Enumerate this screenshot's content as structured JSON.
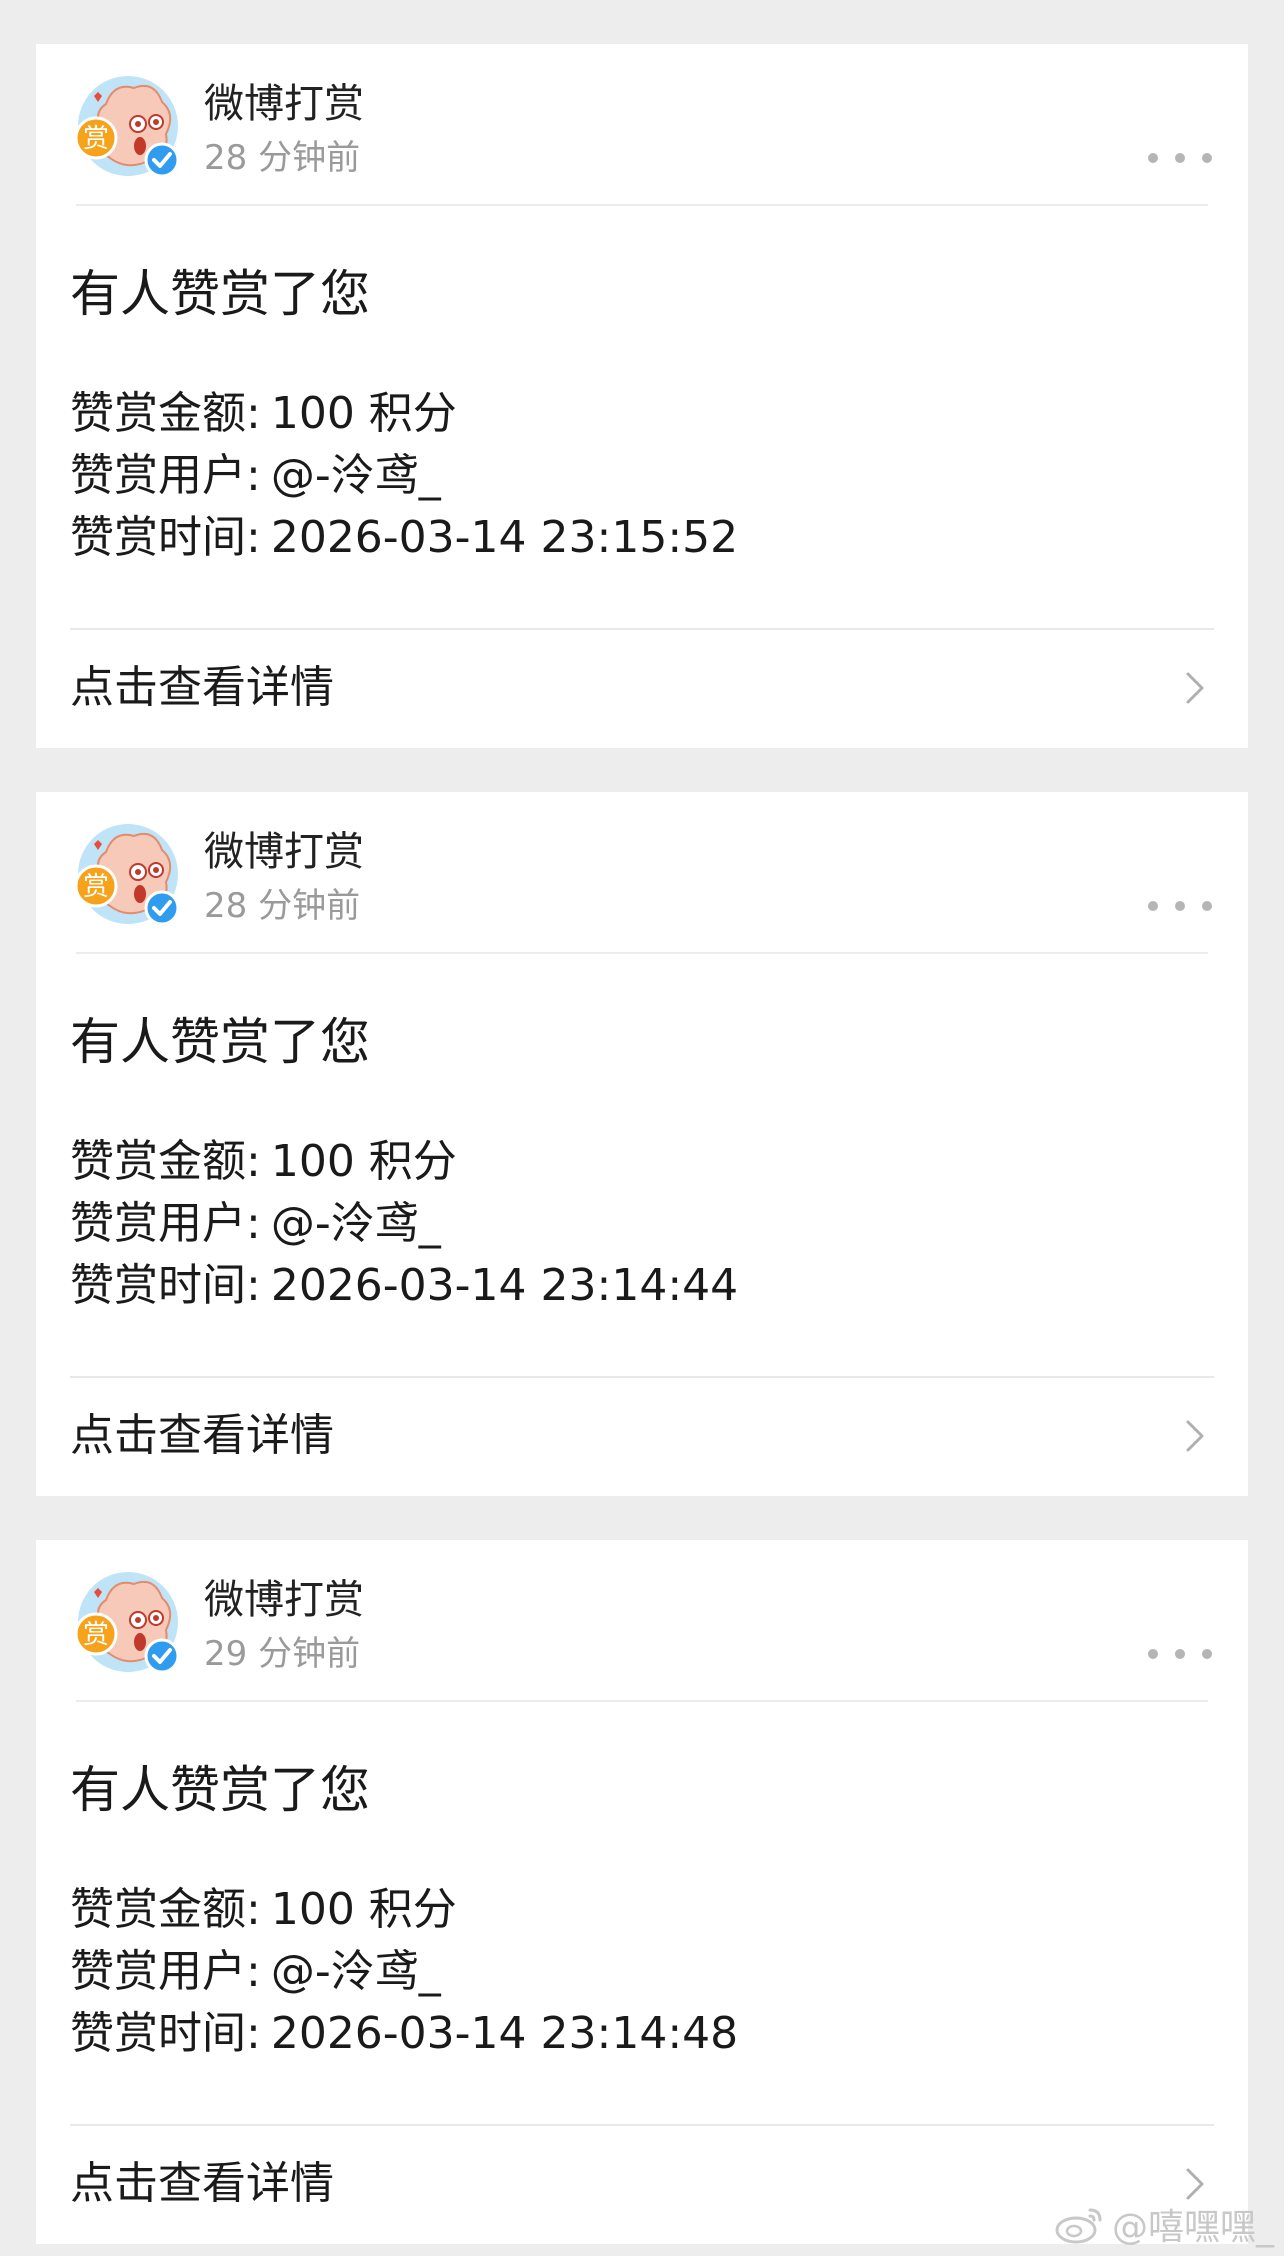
{
  "notifications": [
    {
      "sender": "微博打赏",
      "time": "28 分钟前",
      "title": "有人赞赏了您",
      "amount_label": "赞赏金额:",
      "amount_value": "100 积分",
      "user_label": "赞赏用户:",
      "user_value": "@-泠鸢_",
      "time_label": "赞赏时间:",
      "time_value": "2026-03-14 23:15:52",
      "action_label": "点击查看详情"
    },
    {
      "sender": "微博打赏",
      "time": "28 分钟前",
      "title": "有人赞赏了您",
      "amount_label": "赞赏金额:",
      "amount_value": "100 积分",
      "user_label": "赞赏用户:",
      "user_value": "@-泠鸢_",
      "time_label": "赞赏时间:",
      "time_value": "2026-03-14 23:14:44",
      "action_label": "点击查看详情"
    },
    {
      "sender": "微博打赏",
      "time": "29 分钟前",
      "title": "有人赞赏了您",
      "amount_label": "赞赏金额:",
      "amount_value": "100 积分",
      "user_label": "赞赏用户:",
      "user_value": "@-泠鸢_",
      "time_label": "赞赏时间:",
      "time_value": "2026-03-14 23:14:48",
      "action_label": "点击查看详情"
    }
  ],
  "avatar": {
    "badge_text": "赏",
    "verified_icon": "verified-check-icon"
  },
  "icons": {
    "more": "more-dots-icon",
    "chevron": "chevron-right-icon",
    "watermark": "weibo-logo-icon"
  },
  "colors": {
    "background": "#ededed",
    "card": "#ffffff",
    "muted_text": "#9a9a9a",
    "verified_blue": "#2f9cf0",
    "badge_orange": "#f6a21a"
  },
  "watermark": {
    "text": "@嘻嘿嘿_"
  }
}
